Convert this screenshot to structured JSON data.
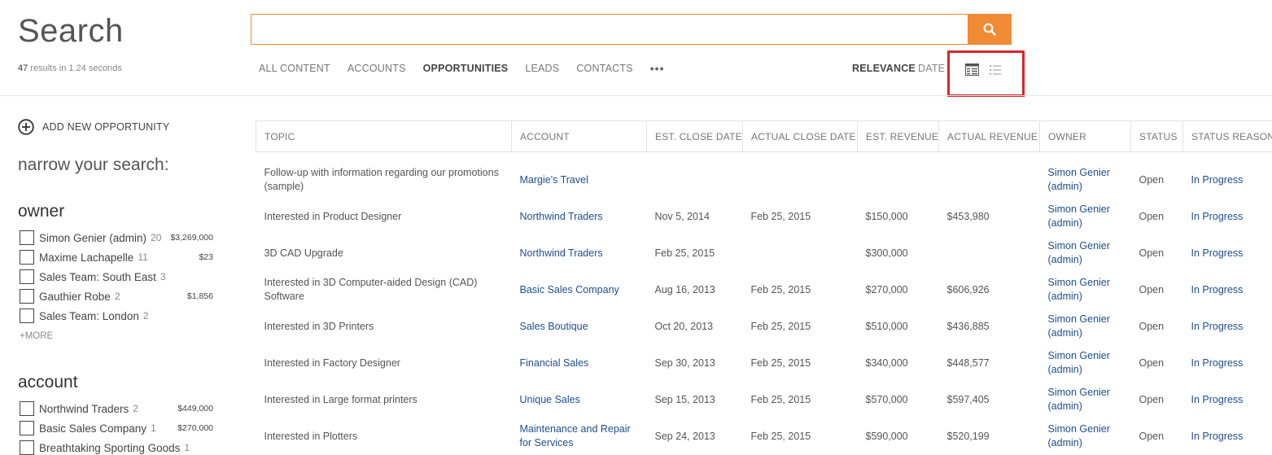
{
  "page": {
    "title": "Search"
  },
  "results": {
    "count": "47",
    "text": "results  in 1.24 seconds"
  },
  "search": {
    "value": "",
    "placeholder": ""
  },
  "tabs": [
    {
      "label": "ALL CONTENT",
      "active": false
    },
    {
      "label": "ACCOUNTS",
      "active": false
    },
    {
      "label": "OPPORTUNITIES",
      "active": true
    },
    {
      "label": "LEADS",
      "active": false
    },
    {
      "label": "CONTACTS",
      "active": false
    }
  ],
  "more_tabs": "•••",
  "sort": {
    "relevance": "RELEVANCE",
    "date": "DATE"
  },
  "add_new": "ADD NEW OPPORTUNITY",
  "narrow": "narrow your search:",
  "facets": {
    "owner": {
      "title": "owner",
      "items": [
        {
          "label": "Simon Genier (admin)",
          "count": "20",
          "amount": "$3,269,000"
        },
        {
          "label": "Maxime Lachapelle",
          "count": "11",
          "amount": "$23"
        },
        {
          "label": "Sales Team: South East",
          "count": "3",
          "amount": ""
        },
        {
          "label": "Gauthier Robe",
          "count": "2",
          "amount": "$1,856"
        },
        {
          "label": "Sales Team: London",
          "count": "2",
          "amount": ""
        }
      ],
      "more": "+MORE"
    },
    "account": {
      "title": "account",
      "items": [
        {
          "label": "Northwind Traders",
          "count": "2",
          "amount": "$449,000"
        },
        {
          "label": "Basic Sales Company",
          "count": "1",
          "amount": "$270,000"
        },
        {
          "label": "Breathtaking Sporting Goods",
          "count": "1",
          "amount": ""
        }
      ]
    }
  },
  "table": {
    "headers": [
      "TOPIC",
      "ACCOUNT",
      "EST. CLOSE DATE",
      "ACTUAL CLOSE DATE",
      "EST. REVENUE",
      "ACTUAL REVENUE",
      "OWNER",
      "STATUS",
      "STATUS REASON"
    ],
    "rows": [
      [
        "Follow-up with information regarding our promotions (sample)",
        "Margie's Travel",
        "",
        "",
        "",
        "",
        "Simon Genier (admin)",
        "Open",
        "In Progress"
      ],
      [
        "Interested in Product Designer",
        "Northwind Traders",
        "Nov 5, 2014",
        "Feb 25, 2015",
        "$150,000",
        "$453,980",
        "Simon Genier (admin)",
        "Open",
        "In Progress"
      ],
      [
        "3D CAD Upgrade",
        "Northwind Traders",
        "Feb 25, 2015",
        "",
        "$300,000",
        "",
        "Simon Genier (admin)",
        "Open",
        "In Progress"
      ],
      [
        "Interested in 3D Computer-aided Design (CAD) Software",
        "Basic Sales Company",
        "Aug 16, 2013",
        "Feb 25, 2015",
        "$270,000",
        "$606,926",
        "Simon Genier (admin)",
        "Open",
        "In Progress"
      ],
      [
        "Interested in 3D Printers",
        "Sales Boutique",
        "Oct 20, 2013",
        "Feb 25, 2015",
        "$510,000",
        "$436,885",
        "Simon Genier (admin)",
        "Open",
        "In Progress"
      ],
      [
        "Interested in Factory Designer",
        "Financial Sales",
        "Sep 30, 2013",
        "Feb 25, 2015",
        "$340,000",
        "$448,577",
        "Simon Genier (admin)",
        "Open",
        "In Progress"
      ],
      [
        "Interested in Large format printers",
        "Unique Sales",
        "Sep 15, 2013",
        "Feb 25, 2015",
        "$570,000",
        "$597,405",
        "Simon Genier (admin)",
        "Open",
        "In Progress"
      ],
      [
        "Interested in Plotters",
        "Maintenance and Repair for Services",
        "Sep 24, 2013",
        "Feb 25, 2015",
        "$590,000",
        "$520,199",
        "Simon Genier (admin)",
        "Open",
        "In Progress"
      ]
    ]
  },
  "colors": {
    "accent": "#f08a34",
    "link": "#1f4e8c",
    "highlight": "#d9262a"
  },
  "icons": {
    "search": "search-icon",
    "add": "plus-circle-icon",
    "grid_view": "grid-view-icon",
    "list_view": "list-view-icon"
  }
}
